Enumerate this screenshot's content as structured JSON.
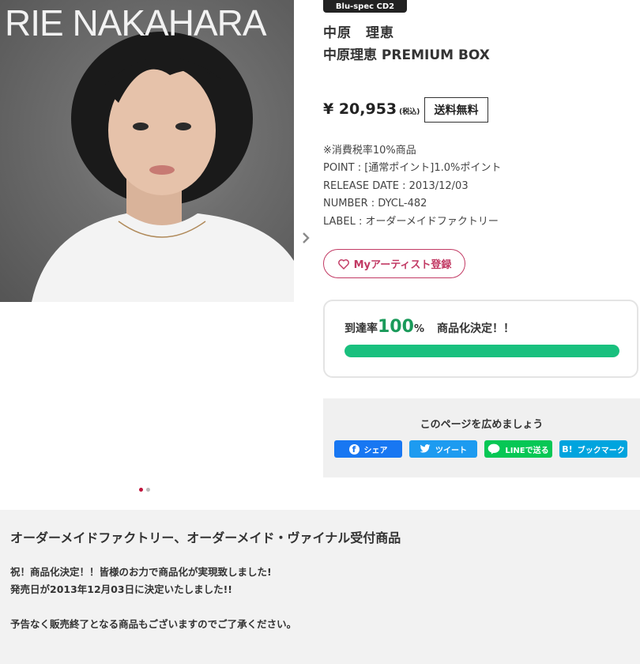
{
  "product": {
    "image_text": "RIE NAKAHARA",
    "format": "Blu-spec CD2",
    "artist": "中原　理恵",
    "title": "中原理恵 PREMIUM BOX",
    "price": "¥ 20,953",
    "tax_note": "(税込)",
    "shipping": "送料無料",
    "info": [
      "※消費税率10%商品",
      "POINT : [通常ポイント]1.0%ポイント",
      "RELEASE DATE : 2013/12/03",
      "NUMBER : DYCL-482",
      "LABEL : オーダーメイドファクトリー"
    ],
    "my_artist_label": "Myアーティスト登録"
  },
  "carousel": {
    "next_icon": "chevron-right-icon",
    "page_count": 2,
    "current_page": 1,
    "active_color": "#c0143c"
  },
  "progress": {
    "prefix": "到達率",
    "percent": "100",
    "percent_sign": "%",
    "status": "商品化決定！！",
    "fraction": 1.0,
    "bar_color": "#19c07e"
  },
  "share": {
    "title": "このページを広めましょう",
    "buttons": {
      "facebook": {
        "label": "シェア",
        "icon": "facebook-icon",
        "color": "#1877f2"
      },
      "twitter": {
        "label": "ツイート",
        "icon": "twitter-bird-icon",
        "color": "#1d9bf0"
      },
      "line": {
        "label": "LINEで送る",
        "icon": "line-icon",
        "color": "#06c755"
      },
      "hatena": {
        "label": "ブックマーク",
        "icon_text": "B!",
        "color": "#00a4de"
      }
    }
  },
  "notice": {
    "title": "オーダーメイドファクトリー、オーダーメイド・ヴァイナル受付商品",
    "lines": [
      "祝！商品化決定！！皆様のお力で商品化が実現致しました!",
      "発売日が2013年12月03日に決定いたしました!!",
      "",
      "予告なく販売終了となる商品もございますのでご了承ください。"
    ]
  }
}
